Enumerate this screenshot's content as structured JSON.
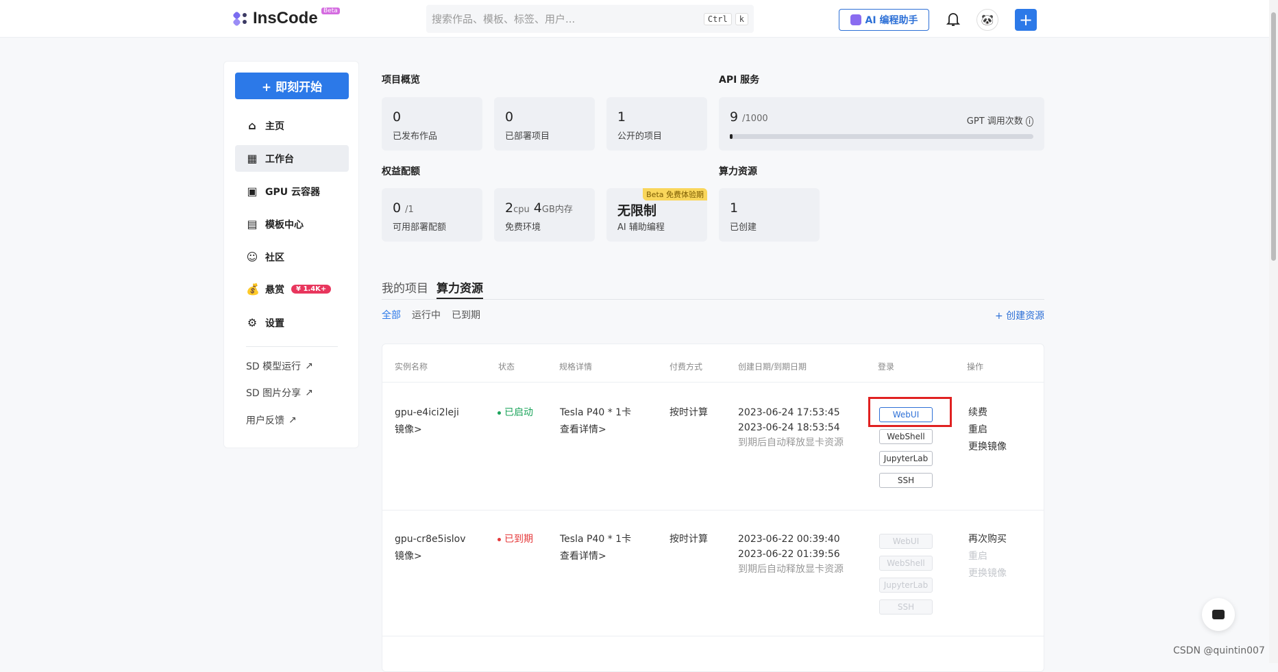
{
  "header": {
    "logo_text": "InsCode",
    "logo_badge": "Beta",
    "search_placeholder": "搜索作品、模板、标签、用户...",
    "kbd1": "Ctrl",
    "kbd2": "k",
    "ai_button": "AI 编程助手"
  },
  "sidebar": {
    "start_button": "+ 即刻开始",
    "items": [
      {
        "label": "主页",
        "icon": "home-icon"
      },
      {
        "label": "工作台",
        "icon": "grid-icon",
        "active": true
      },
      {
        "label": "GPU 云容器",
        "icon": "chip-icon"
      },
      {
        "label": "模板中心",
        "icon": "template-icon"
      },
      {
        "label": "社区",
        "icon": "community-icon"
      },
      {
        "label": "悬赏",
        "icon": "bounty-icon",
        "badge": "¥ 1.4K+"
      },
      {
        "label": "设置",
        "icon": "settings-icon"
      }
    ],
    "links": [
      {
        "label": "SD 模型运行"
      },
      {
        "label": "SD 图片分享"
      },
      {
        "label": "用户反馈"
      }
    ]
  },
  "overview": {
    "title": "项目概览",
    "cards": [
      {
        "value": "0",
        "label": "已发布作品"
      },
      {
        "value": "0",
        "label": "已部署项目"
      },
      {
        "value": "1",
        "label": "公开的项目"
      }
    ]
  },
  "api": {
    "title": "API 服务",
    "value": "9",
    "total": "/1000",
    "label": "GPT 调用次数",
    "usage_fraction": 0.009
  },
  "quota": {
    "title": "权益配额",
    "cards": [
      {
        "value": "0",
        "unit": "/1",
        "label": "可用部署配额"
      },
      {
        "value_a": "2",
        "unit_a": "cpu",
        "value_b": "4",
        "unit_b": "GB内存",
        "label": "免费环境"
      },
      {
        "value": "无限制",
        "label": "AI 辅助编程",
        "tag": "Beta 免费体验期"
      }
    ]
  },
  "compute": {
    "title": "算力资源",
    "value": "1",
    "label": "已创建"
  },
  "tabs": [
    {
      "label": "我的项目"
    },
    {
      "label": "算力资源",
      "active": true
    }
  ],
  "filters": [
    {
      "label": "全部",
      "active": true
    },
    {
      "label": "运行中"
    },
    {
      "label": "已到期"
    }
  ],
  "create_resource": "+ 创建资源",
  "table": {
    "headers": [
      "实例名称",
      "状态",
      "规格详情",
      "付费方式",
      "创建日期/到期日期",
      "登录",
      "操作"
    ],
    "rows": [
      {
        "name": "gpu-e4ici2leji",
        "image_link": "镜像>",
        "status": "已启动",
        "status_color": "#1aa35a",
        "spec": "Tesla P40 * 1卡",
        "spec_link": "查看详情>",
        "billing": "按时计算",
        "created": "2023-06-24 17:53:45",
        "expires": "2023-06-24 18:53:54",
        "note": "到期后自动释放显卡资源",
        "logins": [
          "WebUI",
          "WebShell",
          "JupyterLab",
          "SSH"
        ],
        "actions": [
          "续费",
          "重启",
          "更换镜像"
        ]
      },
      {
        "name": "gpu-cr8e5islov",
        "image_link": "镜像>",
        "status": "已到期",
        "status_color": "#e5393b",
        "spec": "Tesla P40 * 1卡",
        "spec_link": "查看详情>",
        "billing": "按时计算",
        "created": "2023-06-22 00:39:40",
        "expires": "2023-06-22 01:39:56",
        "note": "到期后自动释放显卡资源",
        "logins": [
          "WebUI",
          "WebShell",
          "JupyterLab",
          "SSH"
        ],
        "actions": [
          "再次购买",
          "重启",
          "更换镜像"
        ]
      }
    ]
  },
  "watermark": "CSDN @quintin007"
}
